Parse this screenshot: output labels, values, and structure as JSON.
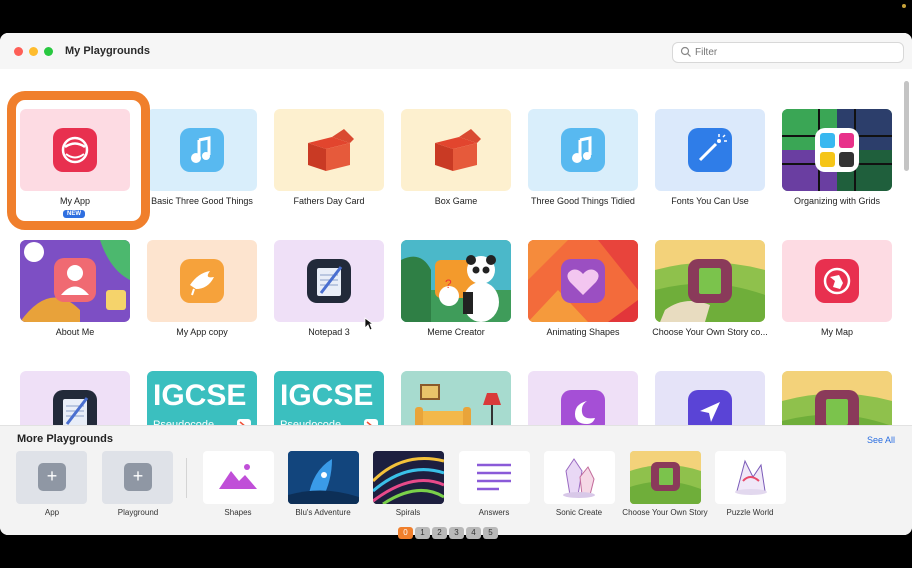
{
  "window": {
    "title": "My Playgrounds",
    "filter_placeholder": "Filter"
  },
  "playgrounds": [
    {
      "label": "My App",
      "badge": "NEW",
      "icon": "globe-icon"
    },
    {
      "label": "Basic Three Good Things",
      "icon": "music-note-icon"
    },
    {
      "label": "Fathers Day Card",
      "icon": "box-icon"
    },
    {
      "label": "Box Game",
      "icon": "box-icon"
    },
    {
      "label": "Three Good Things Tidied",
      "icon": "music-note-icon"
    },
    {
      "label": "Fonts You Can Use",
      "icon": "magic-wand-icon"
    },
    {
      "label": "Organizing with Grids",
      "icon": "grid-icon"
    },
    {
      "label": "About Me",
      "icon": "person-icon"
    },
    {
      "label": "My App copy",
      "icon": "bird-icon"
    },
    {
      "label": "Notepad 3",
      "icon": "notepad-icon"
    },
    {
      "label": "Meme Creator",
      "icon": "panda-icon"
    },
    {
      "label": "Animating Shapes",
      "icon": "heart-icon"
    },
    {
      "label": "Choose Your Own Story co...",
      "icon": "book-icon"
    },
    {
      "label": "My Map",
      "icon": "map-icon"
    },
    {
      "label": "",
      "icon": "notepad-icon"
    },
    {
      "label": "",
      "icon": "igcse-icon"
    },
    {
      "label": "",
      "icon": "igcse-icon"
    },
    {
      "label": "",
      "icon": "room-icon"
    },
    {
      "label": "",
      "icon": "moon-icon"
    },
    {
      "label": "",
      "icon": "location-arrow-icon"
    },
    {
      "label": "",
      "icon": "book-icon"
    }
  ],
  "igcse": {
    "title": "IGCSE",
    "subtitle": "Pseudocode →"
  },
  "more": {
    "title": "More Playgrounds",
    "see_all": "See All",
    "items": [
      {
        "label": "App",
        "icon": "plus-icon"
      },
      {
        "label": "Playground",
        "icon": "plus-icon"
      },
      {
        "label": "Shapes",
        "icon": "shapes-icon"
      },
      {
        "label": "Blu's Adventure",
        "icon": "blu-icon"
      },
      {
        "label": "Spirals",
        "icon": "spirals-icon"
      },
      {
        "label": "Answers",
        "icon": "answers-icon"
      },
      {
        "label": "Sonic Create",
        "icon": "crystal-icon"
      },
      {
        "label": "Choose Your Own Story",
        "icon": "book-icon"
      },
      {
        "label": "Puzzle World",
        "icon": "puzzle-icon"
      }
    ]
  },
  "pagination": [
    "0",
    "1",
    "2",
    "3",
    "4",
    "5"
  ],
  "colors": {
    "accent": "#f07f2c",
    "link": "#2a6ee0",
    "badge": "#2f6fe0"
  }
}
